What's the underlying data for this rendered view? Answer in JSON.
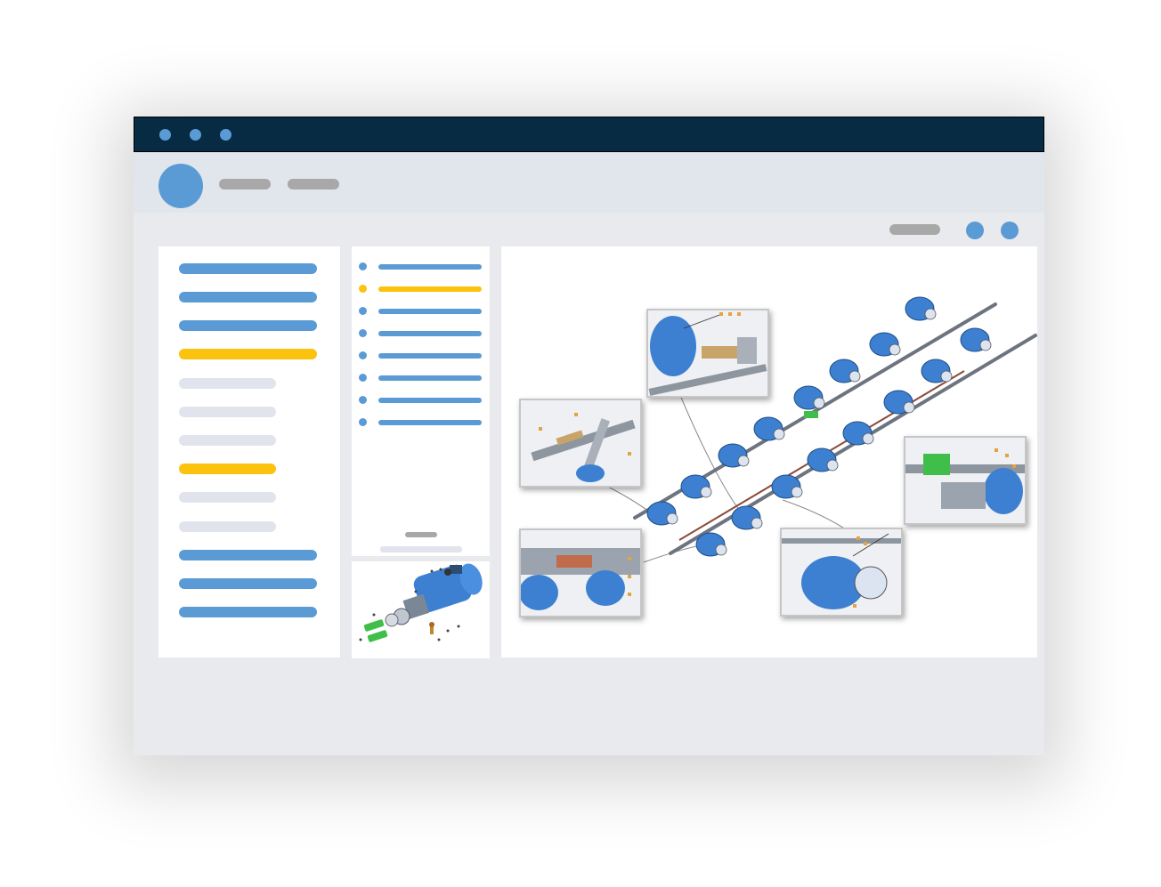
{
  "window": {
    "title_dots": [
      "window-dot",
      "window-dot",
      "window-dot"
    ]
  },
  "header": {
    "nav_items": [
      "",
      ""
    ]
  },
  "toolbar": {
    "buttons": [
      "",
      ""
    ]
  },
  "sidebar": {
    "items": [
      {
        "state": "blue"
      },
      {
        "state": "blue"
      },
      {
        "state": "blue"
      },
      {
        "state": "selected"
      },
      {
        "state": "inactive"
      },
      {
        "state": "inactive"
      },
      {
        "state": "inactive"
      },
      {
        "state": "selected"
      },
      {
        "state": "inactive"
      },
      {
        "state": "inactive"
      },
      {
        "state": "blue"
      },
      {
        "state": "blue"
      },
      {
        "state": "blue"
      }
    ]
  },
  "parts_list": {
    "items": [
      {
        "state": "normal"
      },
      {
        "state": "selected"
      },
      {
        "state": "normal"
      },
      {
        "state": "normal"
      },
      {
        "state": "normal"
      },
      {
        "state": "normal"
      },
      {
        "state": "normal"
      },
      {
        "state": "normal"
      }
    ]
  },
  "colors": {
    "titlebar": "#062b43",
    "accent_blue": "#5b9bd5",
    "highlight_yellow": "#fbc20e",
    "inactive_gray": "#e1e4ec",
    "pill_gray": "#a8a8a8"
  },
  "images": {
    "thumbnail": "exploded-part-drawing",
    "main": "isometric-assembly-drawing-with-callouts"
  }
}
